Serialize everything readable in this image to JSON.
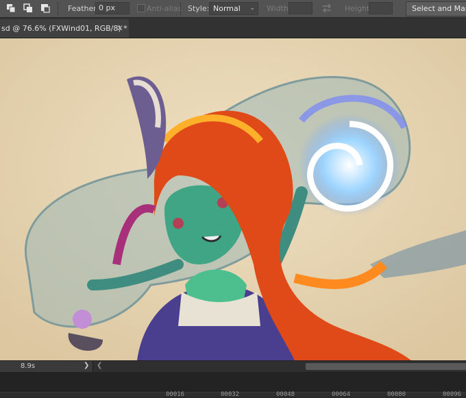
{
  "options_bar": {
    "feather_label": "Feather:",
    "feather_value": "0 px",
    "antialias_label": "Anti-alias",
    "style_label": "Style:",
    "style_value": "Normal",
    "width_label": "Width:",
    "height_label": "Height:",
    "select_mask_label": "Select and Mask..."
  },
  "document_tab": {
    "title": "sd @ 76.6% (FXWind01, RGB/8) *",
    "close_glyph": "✕"
  },
  "status_bar": {
    "text": "8.9s",
    "arrow": "❯",
    "scroll_left": "❮"
  },
  "timeline": {
    "ticks": [
      "00016",
      "00032",
      "00048",
      "00064",
      "00080",
      "00096"
    ]
  },
  "icons": {
    "new_selection": "new-selection-icon",
    "add_selection": "add-to-selection-icon",
    "subtract_selection": "subtract-from-selection-icon",
    "swap": "swap-arrows-icon",
    "close": "close-icon"
  }
}
